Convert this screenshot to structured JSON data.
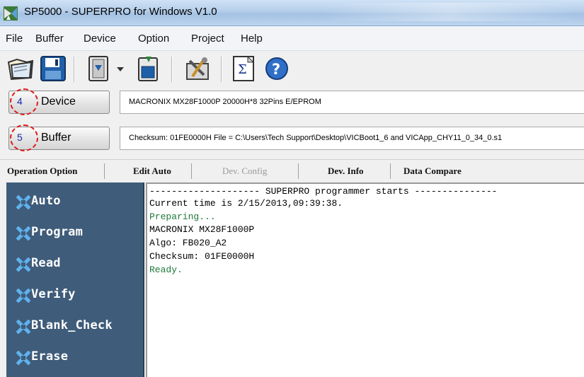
{
  "window": {
    "title": "SP5000 - SUPERPRO for Windows V1.0"
  },
  "menu": {
    "items": [
      "File",
      "Buffer",
      "Device",
      "Option",
      "Project",
      "Help"
    ]
  },
  "toolbar": {
    "icons": [
      "open-folder-icon",
      "save-disk-icon",
      "chip-load-icon",
      "chip-save-icon",
      "tools-icon",
      "checksum-sigma-icon",
      "help-icon"
    ]
  },
  "device_row": {
    "number": "4",
    "button_label": "Device",
    "info": "MACRONIX  MX28F1000P  20000H*8  32Pins  E/EPROM"
  },
  "buffer_row": {
    "number": "5",
    "button_label": "Buffer",
    "info": "Checksum: 01FE0000H    File = C:\\Users\\Tech Support\\Desktop\\VICBoot1_6 and VICApp_CHY11_0_34_0.s1"
  },
  "tabs": [
    {
      "label": "Operation Option",
      "enabled": true
    },
    {
      "label": "Edit Auto",
      "enabled": true
    },
    {
      "label": "Dev. Config",
      "enabled": false
    },
    {
      "label": "Dev. Info",
      "enabled": true
    },
    {
      "label": "Data Compare",
      "enabled": true
    }
  ],
  "operations": [
    "Auto",
    "Program",
    "Read",
    "Verify",
    "Blank_Check",
    "Erase"
  ],
  "log": [
    {
      "text": "-------------------- SUPERPRO programmer starts ---------------",
      "color": "#000000"
    },
    {
      "text": "Current time is 2/15/2013,09:39:38.",
      "color": "#000000"
    },
    {
      "text": "Preparing...",
      "color": "#1e7a3a"
    },
    {
      "text": "MACRONIX MX28F1000P",
      "color": "#000000"
    },
    {
      "text": "Algo: FB020_A2",
      "color": "#000000"
    },
    {
      "text": "Checksum: 01FE0000H",
      "color": "#000000"
    },
    {
      "text": "Ready.",
      "color": "#1e7a3a"
    }
  ],
  "colors": {
    "panel_bg": "#3f5c7a",
    "annotation_ring": "#e01818",
    "status_green": "#1e7a3a"
  }
}
